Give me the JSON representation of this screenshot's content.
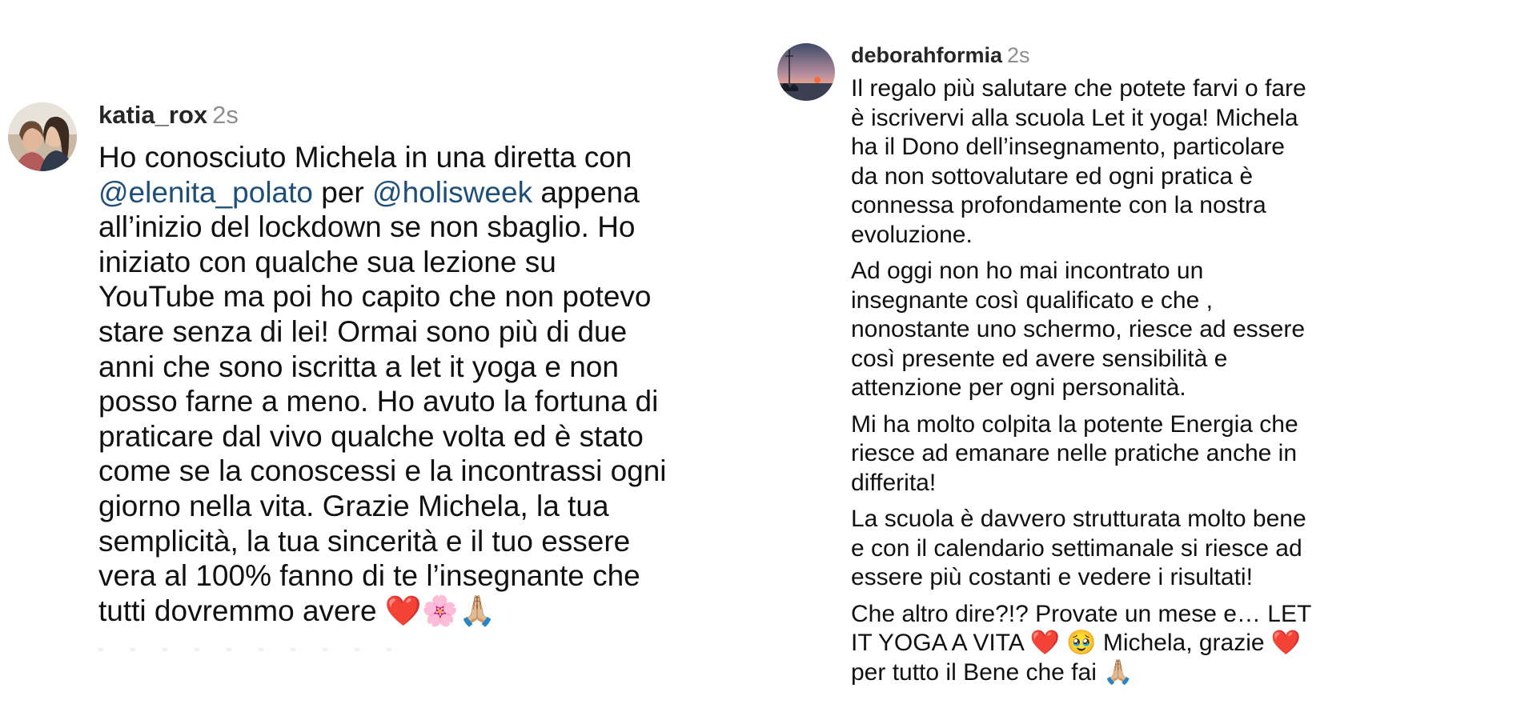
{
  "comments": [
    {
      "username": "katia_rox",
      "time": "2s",
      "lines": [
        [
          {
            "t": "Ho conosciuto Michela in una diretta con"
          }
        ],
        [
          {
            "t": "@elenita_polato",
            "m": true
          },
          {
            "t": " per "
          },
          {
            "t": "@holisweek",
            "m": true
          },
          {
            "t": " appena"
          }
        ],
        [
          {
            "t": "all’inizio del lockdown se non sbaglio. Ho"
          }
        ],
        [
          {
            "t": "iniziato con qualche sua lezione su"
          }
        ],
        [
          {
            "t": "YouTube ma poi ho capito che non potevo"
          }
        ],
        [
          {
            "t": "stare senza di lei! Ormai sono più di due"
          }
        ],
        [
          {
            "t": "anni che sono iscritta a let it yoga e non"
          }
        ],
        [
          {
            "t": "posso farne a meno. Ho avuto la fortuna di"
          }
        ],
        [
          {
            "t": "praticare dal vivo qualche volta ed è stato"
          }
        ],
        [
          {
            "t": "come se la conoscessi e la incontrassi ogni"
          }
        ],
        [
          {
            "t": "giorno nella vita. Grazie Michela, la tua"
          }
        ],
        [
          {
            "t": "semplicità, la tua sincerità e il tuo essere"
          }
        ],
        [
          {
            "t": "vera al 100% fanno di te l’insegnante che"
          }
        ],
        [
          {
            "t": "tutti dovremmo avere ❤️🌸🙏🏼"
          }
        ]
      ]
    },
    {
      "username": "deborahformia",
      "time": "2s",
      "paragraphs": [
        [
          "Il regalo più salutare che potete farvi o fare",
          "è iscrivervi alla scuola Let it yoga! Michela",
          "ha il Dono dell’insegnamento, particolare",
          "da non sottovalutare ed ogni pratica è",
          "connessa profondamente con la nostra",
          "evoluzione."
        ],
        [
          "Ad oggi non ho mai incontrato un",
          "insegnante così qualificato e che ,",
          "nonostante uno schermo, riesce ad essere",
          "così presente ed avere sensibilità e",
          "attenzione per ogni personalità."
        ],
        [
          "Mi ha molto colpita la potente Energia che",
          "riesce ad emanare nelle pratiche anche in",
          "differita!"
        ],
        [
          "La scuola è davvero strutturata molto bene",
          "e con il calendario settimanale si riesce ad",
          "essere più costanti e vedere i risultati!"
        ],
        [
          "Che altro dire?!? Provate un mese e… LET",
          "IT YOGA A VITA ❤️ 🥹  Michela, grazie ❤️",
          "per tutto il Bene che fai 🙏🏼"
        ]
      ]
    }
  ],
  "colors": {
    "username": "#262626",
    "timestamp": "#8e8e8e",
    "mention": "#1f4e79",
    "text": "#111111"
  },
  "icons": [
    "avatar-photo-two-people",
    "avatar-photo-sunset-sea"
  ]
}
